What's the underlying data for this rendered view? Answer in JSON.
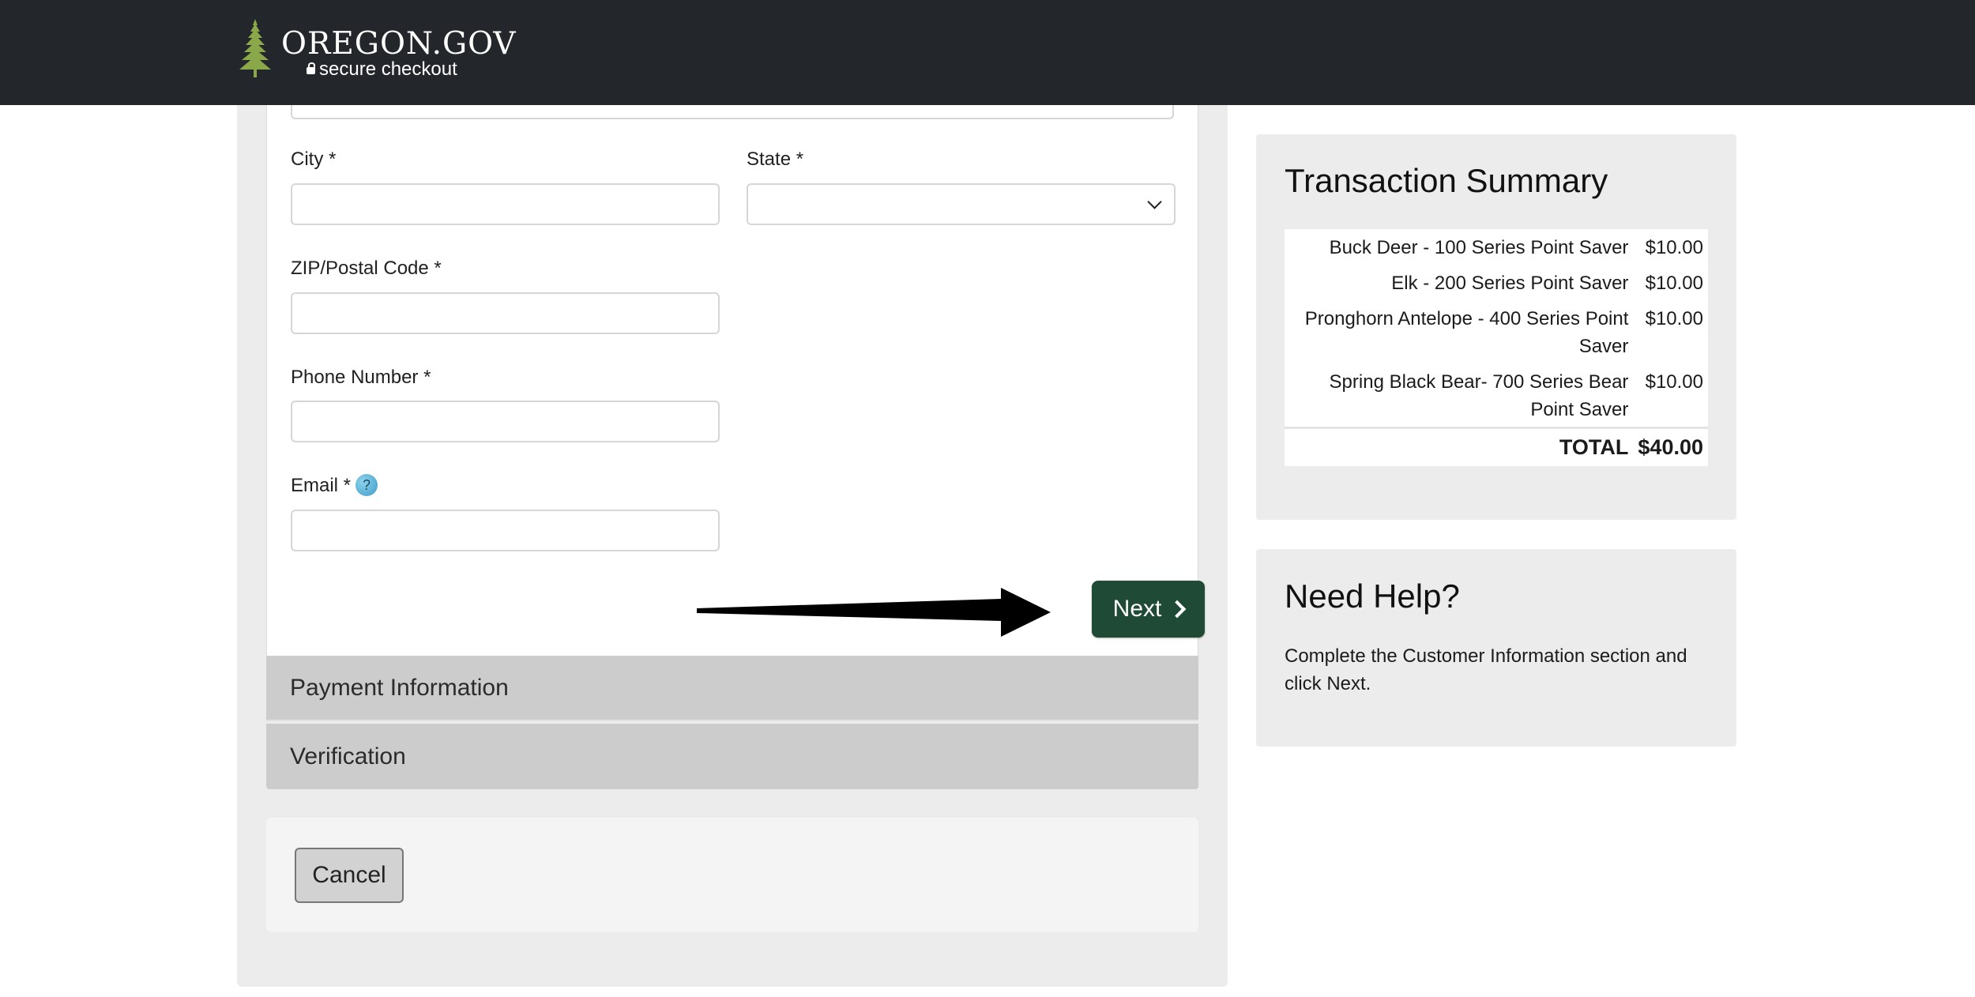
{
  "header": {
    "brand": "OREGON.GOV",
    "subtitle": "secure checkout"
  },
  "form": {
    "city_label": "City *",
    "state_label": "State *",
    "zip_label": "ZIP/Postal Code *",
    "phone_label": "Phone Number *",
    "email_label": "Email *",
    "email_help_icon": "?",
    "city_value": "",
    "state_value": "",
    "zip_value": "",
    "phone_value": "",
    "email_value": "",
    "next_label": "Next"
  },
  "accordion": {
    "payment_label": "Payment Information",
    "verification_label": "Verification"
  },
  "cancel_label": "Cancel",
  "summary": {
    "title": "Transaction Summary",
    "items": [
      {
        "name": "Buck Deer - 100 Series Point Saver",
        "amount": "$10.00"
      },
      {
        "name": "Elk - 200 Series Point Saver",
        "amount": "$10.00"
      },
      {
        "name": "Pronghorn Antelope - 400 Series Point Saver",
        "amount": "$10.00"
      },
      {
        "name": "Spring Black Bear- 700 Series Bear Point Saver",
        "amount": "$10.00"
      }
    ],
    "total_label": "TOTAL",
    "total_amount": "$40.00"
  },
  "help": {
    "title": "Need Help?",
    "text": "Complete the Customer Information section and click Next."
  },
  "colors": {
    "header_bg": "#23262b",
    "next_button": "#1f4a36",
    "logo_tree": "#8aa84a"
  }
}
